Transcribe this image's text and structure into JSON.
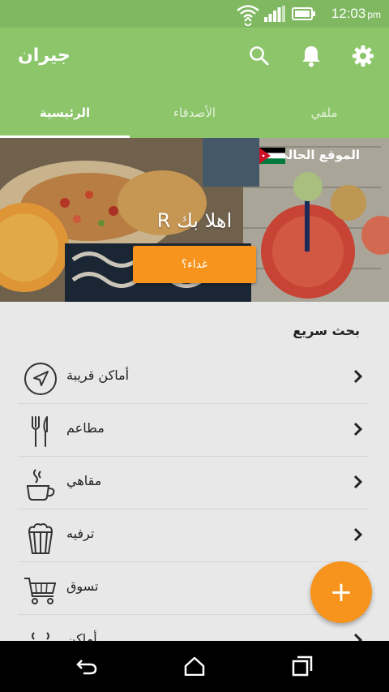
{
  "status_bar": {
    "time": "12:03",
    "ampm": "pm"
  },
  "app": {
    "title": "جيران"
  },
  "tabs": [
    {
      "label": "الرئيسية"
    },
    {
      "label": "الأصدقاء"
    },
    {
      "label": "ملفي"
    }
  ],
  "hero": {
    "location_label": "الموقع الحالي",
    "greeting": "اهلا بك R",
    "cta_label": "غداء؟"
  },
  "quick_search": {
    "title": "بحث سريع",
    "items": [
      {
        "label": "أماكن قريبة",
        "icon": "navigation-icon"
      },
      {
        "label": "مطاعم",
        "icon": "fork-knife-icon"
      },
      {
        "label": "مقاهي",
        "icon": "coffee-cup-icon"
      },
      {
        "label": "ترفيه",
        "icon": "popcorn-icon"
      },
      {
        "label": "تسوق",
        "icon": "shopping-cart-icon"
      },
      {
        "label": "أماكن",
        "icon": "places-icon"
      }
    ]
  },
  "fab": {
    "label": "+"
  },
  "colors": {
    "primary": "#8cc56a",
    "accent": "#f7941d"
  }
}
